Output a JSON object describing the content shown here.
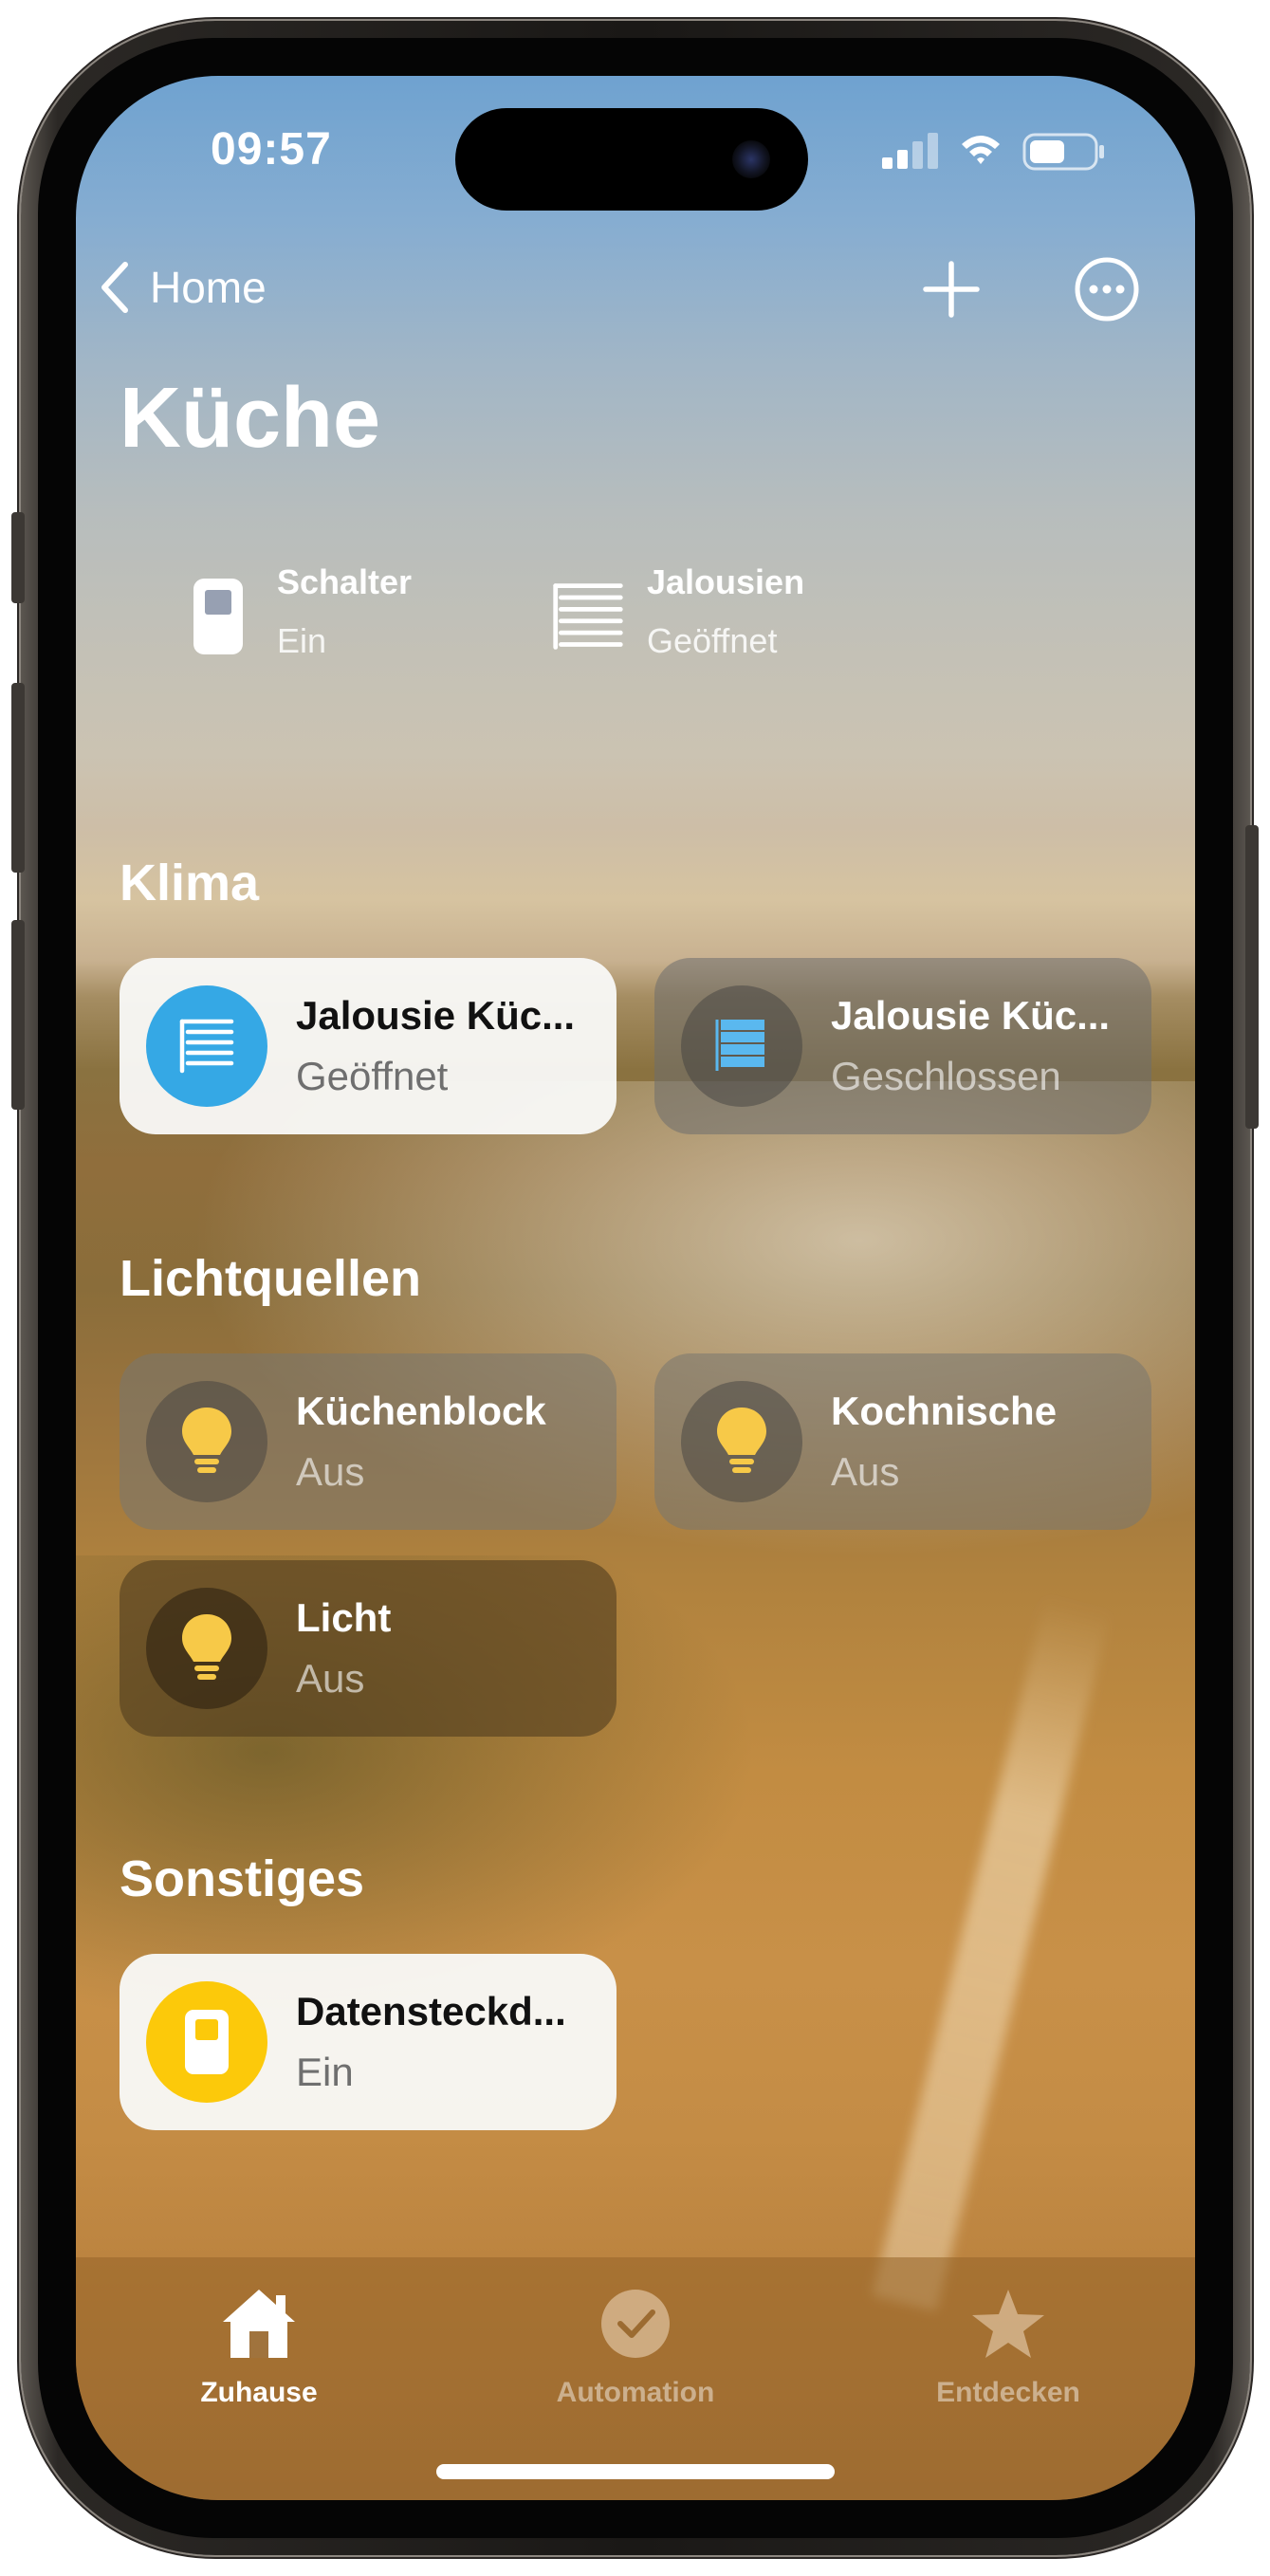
{
  "status_bar": {
    "time": "09:57"
  },
  "nav": {
    "back_label": "Home",
    "title": "Küche"
  },
  "summary": [
    {
      "title": "Schalter",
      "status": "Ein",
      "icon": "switch-icon"
    },
    {
      "title": "Jalousien",
      "status": "Geöffnet",
      "icon": "blinds-icon"
    }
  ],
  "sections": {
    "klima": {
      "heading": "Klima",
      "tiles": [
        {
          "title": "Jalousie Küc...",
          "status": "Geöffnet",
          "state": "on",
          "icon": "blinds-icon",
          "accent": "#35a8e5"
        },
        {
          "title": "Jalousie Küc...",
          "status": "Geschlossen",
          "state": "off",
          "icon": "blinds-closed-icon",
          "accent": "#5ab8ef"
        }
      ]
    },
    "licht": {
      "heading": "Lichtquellen",
      "tiles": [
        {
          "title": "Küchenblock",
          "status": "Aus",
          "state": "off",
          "icon": "lightbulb-icon",
          "accent": "#f7c948"
        },
        {
          "title": "Kochnische",
          "status": "Aus",
          "state": "off",
          "icon": "lightbulb-icon",
          "accent": "#f7c948"
        },
        {
          "title": "Licht",
          "status": "Aus",
          "state": "off",
          "icon": "lightbulb-icon",
          "accent": "#f7c948"
        }
      ]
    },
    "sonstiges": {
      "heading": "Sonstiges",
      "tiles": [
        {
          "title": "Datensteckd...",
          "status": "Ein",
          "state": "on",
          "icon": "switch-icon",
          "accent": "#fcc90a"
        }
      ]
    }
  },
  "tabbar": {
    "tabs": [
      {
        "label": "Zuhause",
        "icon": "house-icon",
        "active": true
      },
      {
        "label": "Automation",
        "icon": "clock-check-icon",
        "active": false
      },
      {
        "label": "Entdecken",
        "icon": "star-icon",
        "active": false
      }
    ]
  },
  "colors": {
    "accent_blue": "#35a8e5",
    "accent_yellow": "#fcc90a",
    "bulb_yellow": "#f7c948"
  }
}
